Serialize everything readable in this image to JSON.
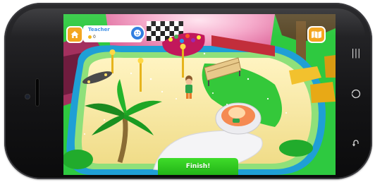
{
  "player": {
    "name": "Teacher",
    "coins": "0"
  },
  "actions": {
    "finish_label": "Finish!"
  },
  "icons": {
    "home": "home-icon",
    "map": "map-icon",
    "avatar": "avatar-icon",
    "nav_menu": "menu-lines-icon",
    "nav_home": "circle-home-icon",
    "nav_back": "back-arrow-icon"
  },
  "colors": {
    "grass": "#27c23c",
    "path": "#f5e9a6",
    "hud_orange": "#f3a51e",
    "finish_green": "#2fcb22",
    "name_blue": "#3d8fe6"
  }
}
